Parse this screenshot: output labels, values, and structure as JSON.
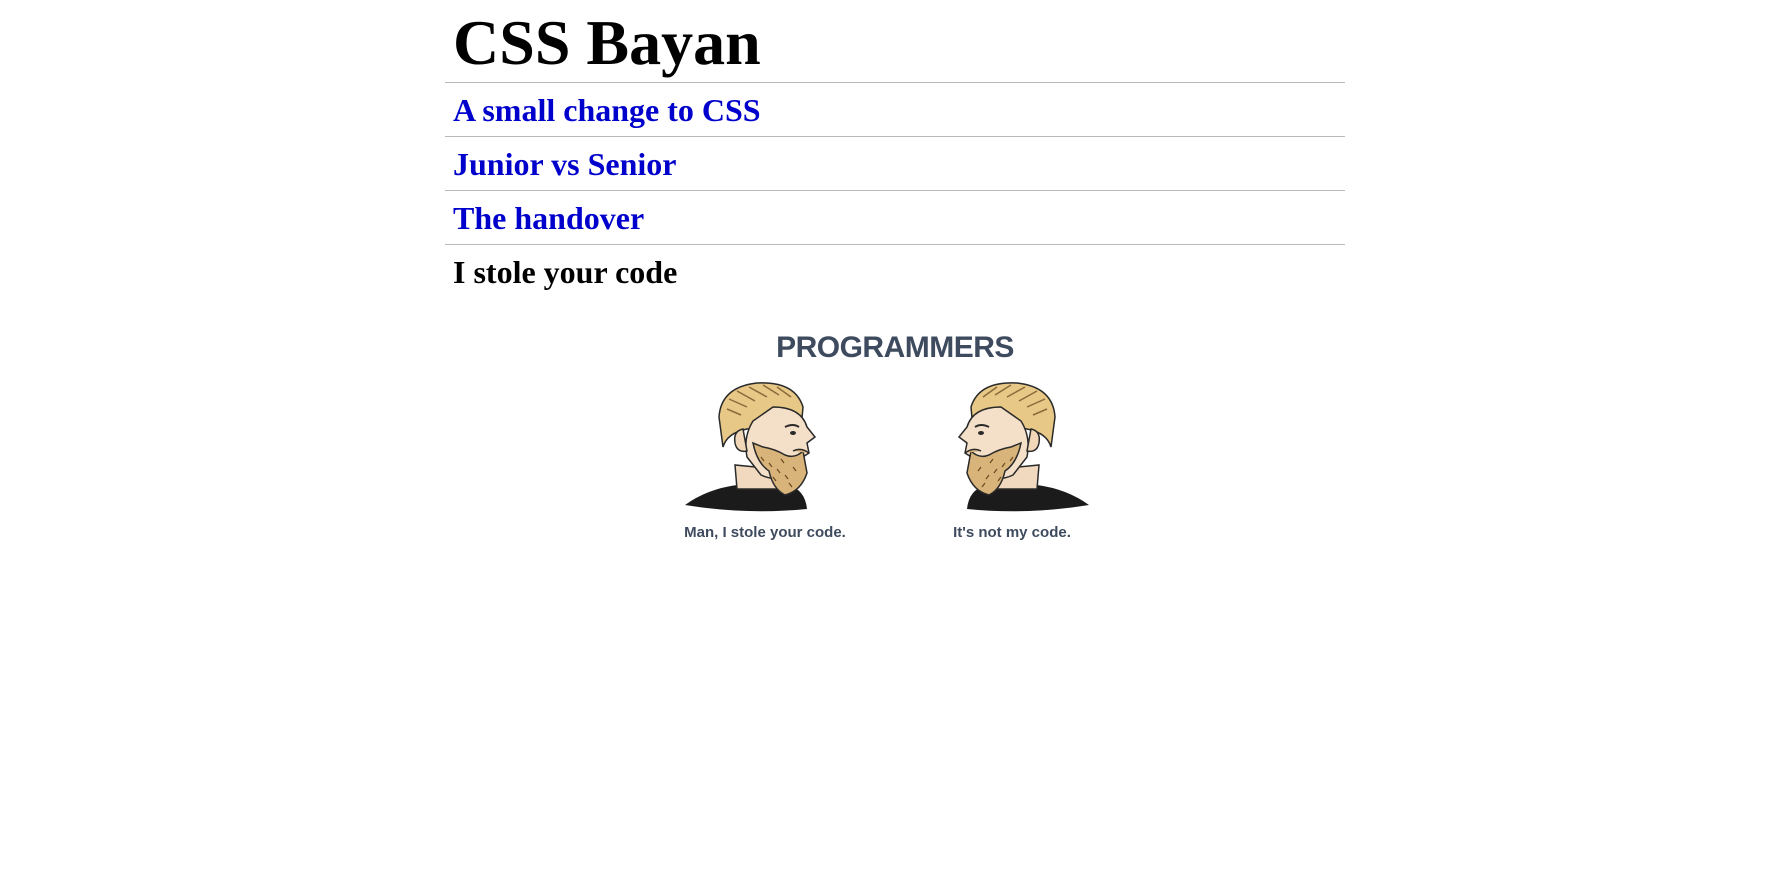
{
  "site": {
    "title": "CSS Bayan"
  },
  "nav": {
    "items": [
      {
        "label": "A small change to CSS",
        "link_color": "#0000cc"
      },
      {
        "label": "Junior vs Senior",
        "link_color": "#0000cc"
      },
      {
        "label": "The handover",
        "link_color": "#0000cc"
      }
    ],
    "current": "I stole your code"
  },
  "meme": {
    "title": "PROGRAMMERS",
    "left_caption": "Man, I stole your code.",
    "right_caption": "It's not my code.",
    "text_color": "#3e4b5e"
  }
}
